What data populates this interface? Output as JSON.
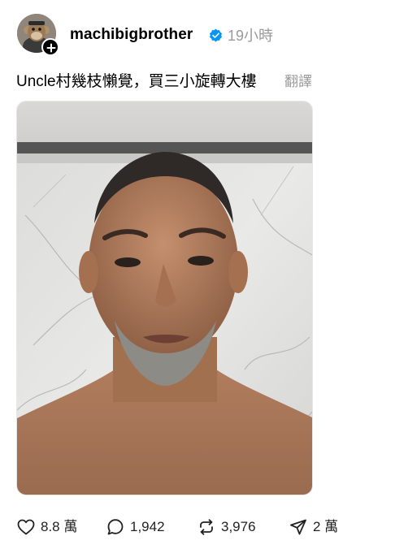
{
  "header": {
    "username": "machibigbrother",
    "timestamp": "19小時",
    "verified": true,
    "avatar": "cartoon-monkey-avatar",
    "follow_badge_icon": "plus-icon"
  },
  "post": {
    "caption": "Uncle村幾枝懶覺，買三小旋轉大樓",
    "translate_label": "翻譯",
    "image": "selfie-photo-bald-man-marble-wall"
  },
  "actions": {
    "like": {
      "icon": "heart-icon",
      "count": "8.8 萬"
    },
    "reply": {
      "icon": "comment-bubble-icon",
      "count": "1,942"
    },
    "repost": {
      "icon": "repost-arrows-icon",
      "count": "3,976"
    },
    "share": {
      "icon": "send-paper-plane-icon",
      "count": "2 萬"
    }
  },
  "colors": {
    "text": "#000000",
    "secondary_text": "#9a9a9a",
    "verified_blue": "#0095f6",
    "background": "#ffffff"
  }
}
